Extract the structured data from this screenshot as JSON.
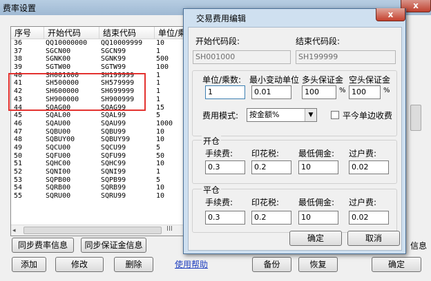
{
  "main": {
    "title": "费率设置",
    "close_glyph": "x",
    "columns": [
      "序号",
      "开始代码",
      "结束代码",
      "单位/乘"
    ],
    "rows": [
      [
        "36",
        "QQ10000000",
        "QQ10009999",
        "10"
      ],
      [
        "37",
        "SGCN00",
        "SGCN99",
        "1"
      ],
      [
        "38",
        "SGNK00",
        "SGNK99",
        "500"
      ],
      [
        "39",
        "SGTW00",
        "SGTW99",
        "100"
      ],
      [
        "40",
        "SH001000",
        "SH199999",
        "1"
      ],
      [
        "41",
        "SH500000",
        "SH579999",
        "1"
      ],
      [
        "42",
        "SH600000",
        "SH699999",
        "1"
      ],
      [
        "43",
        "SH900000",
        "SH900999",
        "1"
      ],
      [
        "44",
        "SQAG00",
        "SQAG99",
        "15"
      ],
      [
        "45",
        "SQAL00",
        "SQAL99",
        "5"
      ],
      [
        "46",
        "SQAU00",
        "SQAU99",
        "1000"
      ],
      [
        "47",
        "SQBU00",
        "SQBU99",
        "10"
      ],
      [
        "48",
        "SQBUY00",
        "SQBUY99",
        "10"
      ],
      [
        "49",
        "SQCU00",
        "SQCU99",
        "5"
      ],
      [
        "50",
        "SQFU00",
        "SQFU99",
        "50"
      ],
      [
        "51",
        "SQHC00",
        "SQHC99",
        "10"
      ],
      [
        "52",
        "SQNI00",
        "SQNI99",
        "1"
      ],
      [
        "53",
        "SQPB00",
        "SQPB99",
        "5"
      ],
      [
        "54",
        "SQRB00",
        "SQRB99",
        "10"
      ],
      [
        "55",
        "SQRU00",
        "SQRU99",
        "10"
      ]
    ],
    "scroll_left": "◂",
    "scroll_grip": "III",
    "right_text": "信息",
    "buttons": {
      "sync_fee": "同步费率信息",
      "sync_margin": "同步保证金信息",
      "add": "添加",
      "edit": "修改",
      "delete": "删除",
      "help": "使用帮助",
      "backup": "备份",
      "restore": "恢复",
      "ok": "确定"
    }
  },
  "dialog": {
    "title": "交易费用编辑",
    "close_glyph": "x",
    "start_label": "开始代码段:",
    "end_label": "结束代码段:",
    "start_value": "SH001000",
    "end_value": "SH199999",
    "unit_label": "单位/乘数:",
    "min_tick_label": "最小变动单位",
    "long_margin_label": "多头保证金",
    "short_margin_label": "空头保证金",
    "unit_value": "1",
    "min_tick_value": "0.01",
    "long_margin_value": "100",
    "short_margin_value": "100",
    "percent": "%",
    "fee_mode_label": "费用模式:",
    "fee_mode_value": "按金额%",
    "dropdown_arrow": "▼",
    "close_today_label": "平今单边收费",
    "open_group": {
      "title": "开仓",
      "labels": [
        "手续费:",
        "印花税:",
        "最低佣金:",
        "过户费:"
      ],
      "values": [
        "0.3",
        "0.2",
        "10",
        "0.02"
      ]
    },
    "close_group": {
      "title": "平仓",
      "labels": [
        "手续费:",
        "印花税:",
        "最低佣金:",
        "过户费:"
      ],
      "values": [
        "0.3",
        "0.2",
        "10",
        "0.02"
      ]
    },
    "ok": "确定",
    "cancel": "取消"
  }
}
